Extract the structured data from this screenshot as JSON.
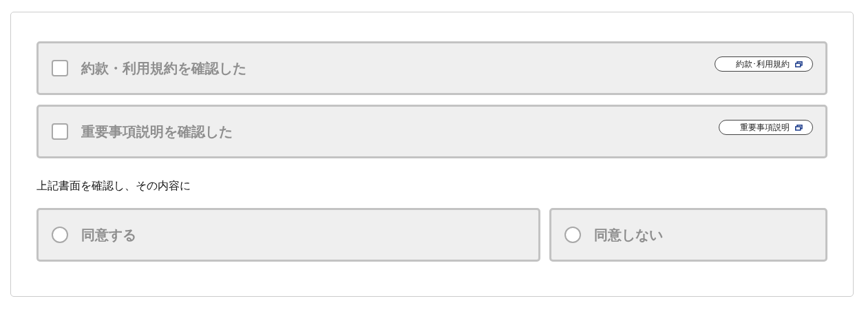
{
  "checkboxes": [
    {
      "label": "約款・利用規約を確認した",
      "checked": false,
      "disabled": true,
      "link": "約款･利用規約"
    },
    {
      "label": "重要事項説明を確認した",
      "checked": false,
      "disabled": true,
      "link": "重要事項説明"
    }
  ],
  "prompt": "上記書面を確認し、その内容に",
  "options": [
    {
      "label": "同意する",
      "selected": false,
      "disabled": true
    },
    {
      "label": "同意しない",
      "selected": false,
      "disabled": true
    }
  ]
}
